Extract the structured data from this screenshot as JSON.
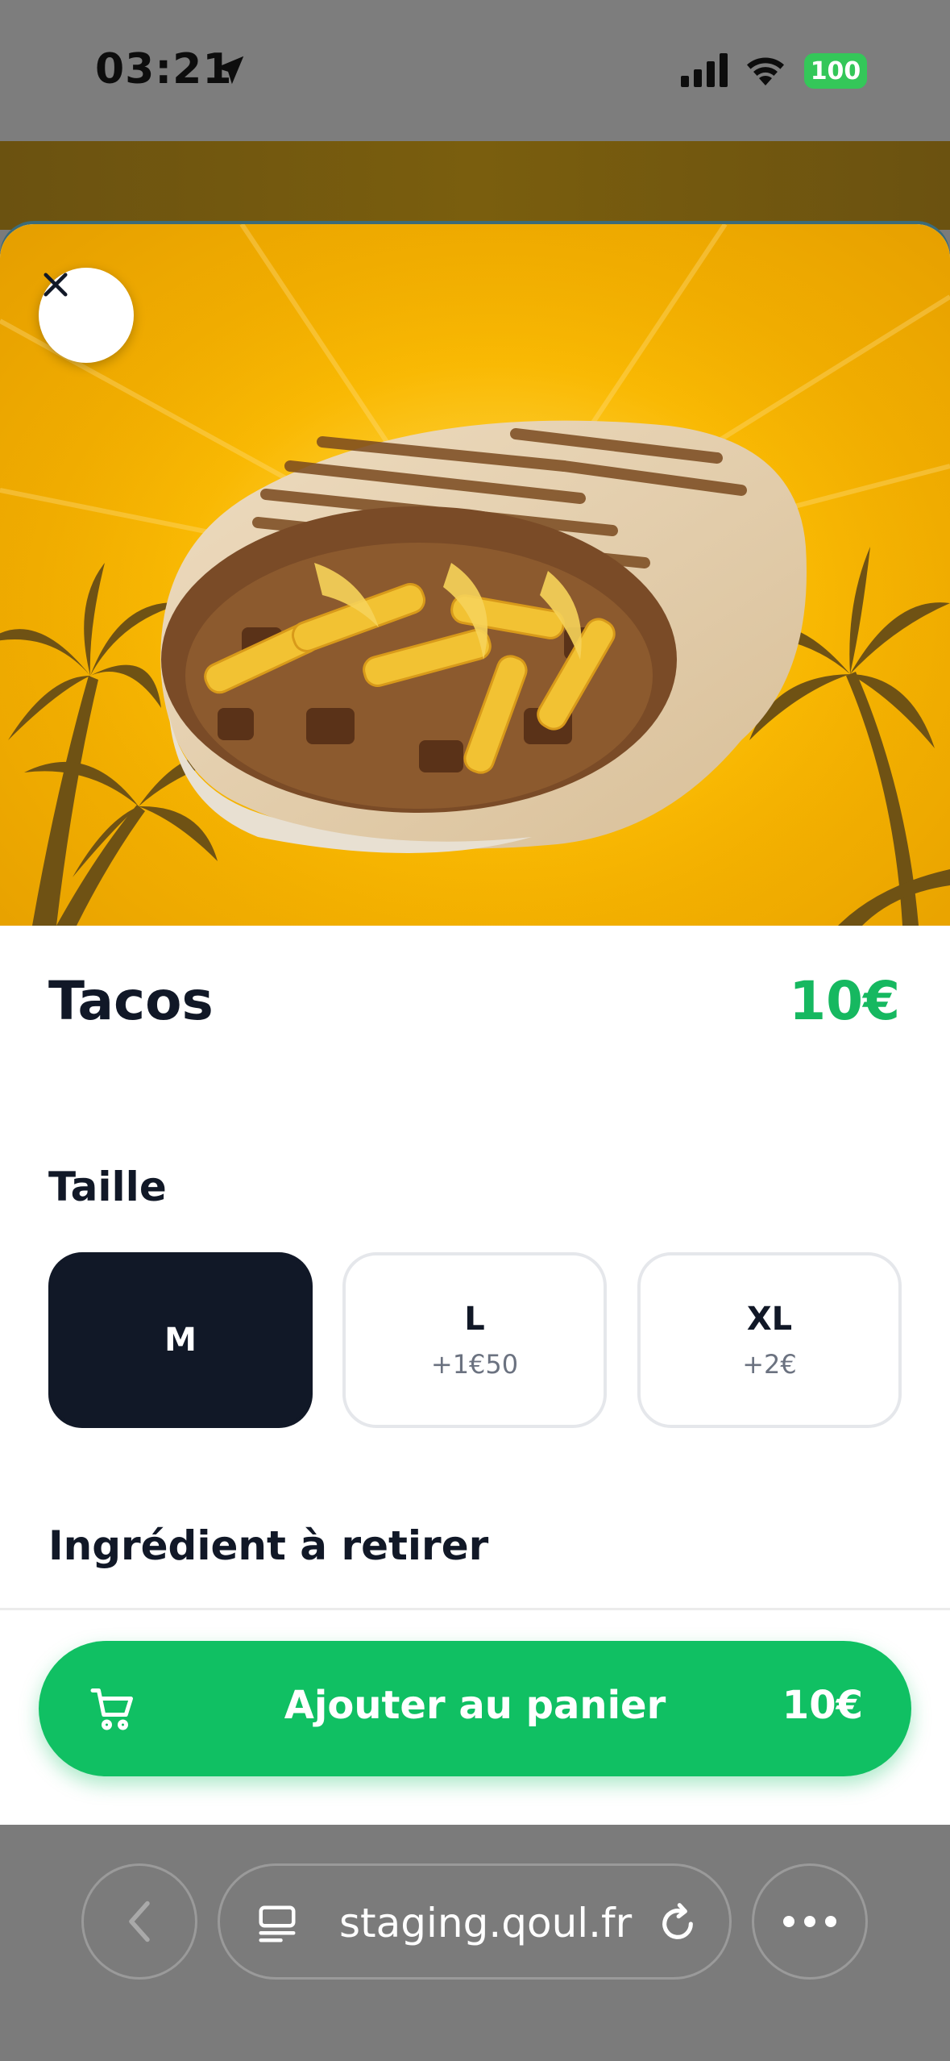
{
  "status_bar": {
    "time": "03:21",
    "battery": "100"
  },
  "product": {
    "title": "Tacos",
    "price": "10€",
    "image_alt": "tacos-hero-image"
  },
  "size": {
    "heading": "Taille",
    "options": [
      {
        "label": "M",
        "extra": "",
        "selected": true
      },
      {
        "label": "L",
        "extra": "+1€50",
        "selected": false
      },
      {
        "label": "XL",
        "extra": "+2€",
        "selected": false
      }
    ]
  },
  "ingredients": {
    "heading": "Ingrédient à retirer"
  },
  "cart_button": {
    "label": "Ajouter au panier",
    "price": "10€"
  },
  "browser": {
    "url": "staging.qoul.fr"
  },
  "colors": {
    "accent": "#10c063",
    "price": "#16b860",
    "dark": "#111827",
    "hero_bg": "#f7b500"
  }
}
